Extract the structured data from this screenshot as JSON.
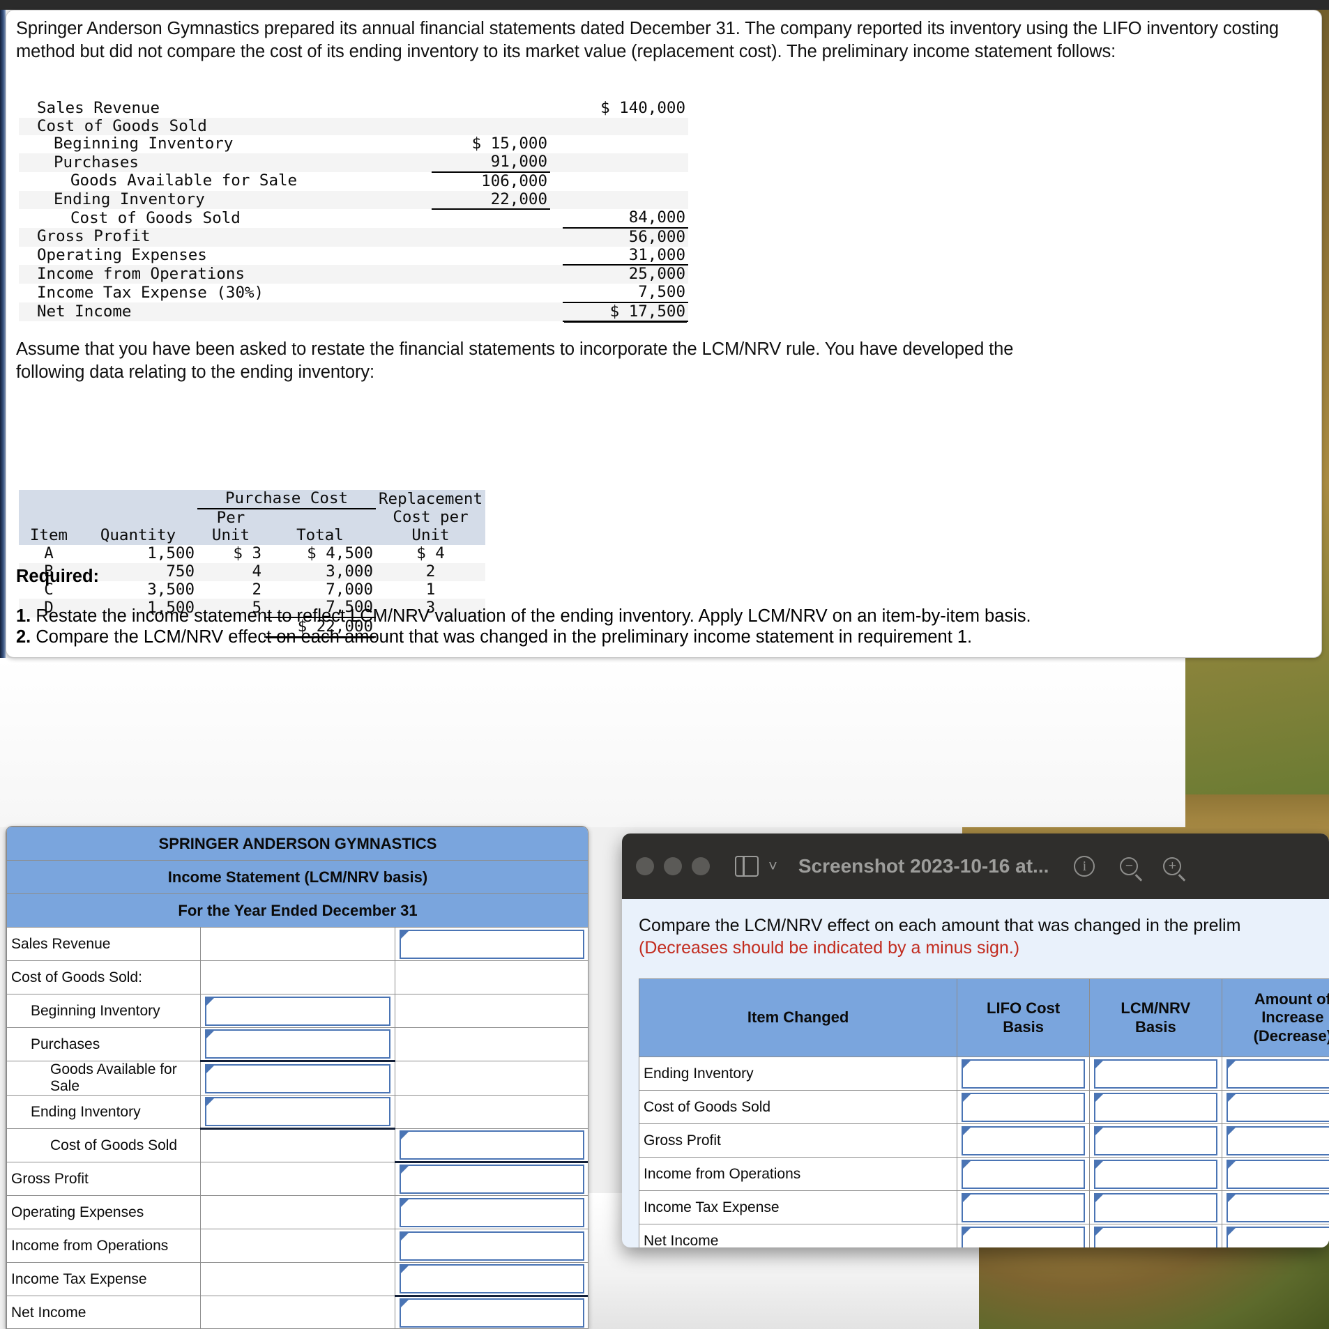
{
  "document": {
    "intro_paragraph": "Springer Anderson Gymnastics prepared its annual financial statements dated December 31. The company reported its inventory using the LIFO inventory costing method but did not compare the cost of its ending inventory to its market value (replacement cost). The preliminary income statement follows:",
    "assume_paragraph": "Assume that you have been asked to restate the financial statements to incorporate the LCM/NRV rule. You have developed the following data relating to the ending inventory:",
    "required_heading": "Required:",
    "requirements": [
      {
        "number": "1.",
        "text": " Restate the income statement to reflect LCM/NRV valuation of the ending inventory. Apply LCM/NRV on an item-by-item basis."
      },
      {
        "number": "2.",
        "text": " Compare the LCM/NRV effect on each amount that was changed in the preliminary income statement in requirement 1."
      }
    ]
  },
  "preliminary_income_statement": {
    "rows": [
      {
        "label": "Sales Revenue",
        "indent": 0,
        "col1": "",
        "col2": "$ 140,000",
        "col1_rule": "none",
        "col2_rule": "none"
      },
      {
        "label": "Cost of Goods Sold",
        "indent": 0,
        "col1": "",
        "col2": "",
        "col1_rule": "none",
        "col2_rule": "none"
      },
      {
        "label": "Beginning Inventory",
        "indent": 1,
        "col1": "$ 15,000",
        "col2": "",
        "col1_rule": "none",
        "col2_rule": "none"
      },
      {
        "label": "Purchases",
        "indent": 1,
        "col1": "91,000",
        "col2": "",
        "col1_rule": "single",
        "col2_rule": "none"
      },
      {
        "label": "Goods Available for Sale",
        "indent": 2,
        "col1": "106,000",
        "col2": "",
        "col1_rule": "none",
        "col2_rule": "none"
      },
      {
        "label": "Ending Inventory",
        "indent": 1,
        "col1": "22,000",
        "col2": "",
        "col1_rule": "single",
        "col2_rule": "none"
      },
      {
        "label": "Cost of Goods Sold",
        "indent": 2,
        "col1": "",
        "col2": "84,000",
        "col1_rule": "none",
        "col2_rule": "single"
      },
      {
        "label": "Gross Profit",
        "indent": 0,
        "col1": "",
        "col2": "56,000",
        "col1_rule": "none",
        "col2_rule": "none"
      },
      {
        "label": "Operating Expenses",
        "indent": 0,
        "col1": "",
        "col2": "31,000",
        "col1_rule": "none",
        "col2_rule": "single"
      },
      {
        "label": "Income from Operations",
        "indent": 0,
        "col1": "",
        "col2": "25,000",
        "col1_rule": "none",
        "col2_rule": "none"
      },
      {
        "label": "Income Tax Expense (30%)",
        "indent": 0,
        "col1": "",
        "col2": "7,500",
        "col1_rule": "none",
        "col2_rule": "single"
      },
      {
        "label": "Net Income",
        "indent": 0,
        "col1": "",
        "col2": "$ 17,500",
        "col1_rule": "none",
        "col2_rule": "double"
      }
    ]
  },
  "purchase_cost_table": {
    "group_header": "Purchase Cost",
    "replacement_header_line1": "Replacement",
    "replacement_header_line2": "Cost per",
    "per_line1": "Per",
    "headers": {
      "item": "Item",
      "quantity": "Quantity",
      "per_unit": "Unit",
      "total": "Total",
      "replacement_unit": "Unit"
    },
    "rows": [
      {
        "item": "A",
        "quantity": "1,500",
        "per_unit": "$ 3",
        "total": "$ 4,500",
        "replacement": "$ 4"
      },
      {
        "item": "B",
        "quantity": "750",
        "per_unit": "4",
        "total": "3,000",
        "replacement": "2"
      },
      {
        "item": "C",
        "quantity": "3,500",
        "per_unit": "2",
        "total": "7,000",
        "replacement": "1"
      },
      {
        "item": "D",
        "quantity": "1,500",
        "per_unit": "5",
        "total": "7,500",
        "replacement": "3"
      }
    ],
    "total_row": {
      "total": "$ 22,000"
    }
  },
  "answer_sheet": {
    "title_line1": "SPRINGER ANDERSON GYMNASTICS",
    "title_line2": "Income Statement (LCM/NRV basis)",
    "title_line3": "For the Year Ended December 31",
    "rows": [
      {
        "label": "Sales Revenue",
        "indent": 0,
        "col_a": "",
        "col_b": "input",
        "under_a": false,
        "under_b": false
      },
      {
        "label": "Cost of Goods Sold:",
        "indent": 0,
        "col_a": "",
        "col_b": "",
        "under_a": false,
        "under_b": false
      },
      {
        "label": "Beginning Inventory",
        "indent": 1,
        "col_a": "input",
        "col_b": "",
        "under_a": false,
        "under_b": false
      },
      {
        "label": "Purchases",
        "indent": 1,
        "col_a": "input",
        "col_b": "",
        "under_a": true,
        "under_b": false
      },
      {
        "label": "Goods Available for Sale",
        "indent": 2,
        "col_a": "input",
        "col_b": "",
        "under_a": false,
        "under_b": false
      },
      {
        "label": "Ending Inventory",
        "indent": 1,
        "col_a": "input",
        "col_b": "",
        "under_a": true,
        "under_b": false
      },
      {
        "label": "Cost of Goods Sold",
        "indent": 2,
        "col_a": "",
        "col_b": "input",
        "under_a": false,
        "under_b": true
      },
      {
        "label": "Gross Profit",
        "indent": 0,
        "col_a": "",
        "col_b": "input",
        "under_a": false,
        "under_b": false
      },
      {
        "label": "Operating Expenses",
        "indent": 0,
        "col_a": "",
        "col_b": "input",
        "under_a": false,
        "under_b": false
      },
      {
        "label": "Income from Operations",
        "indent": 0,
        "col_a": "",
        "col_b": "input",
        "under_a": false,
        "under_b": false
      },
      {
        "label": "Income Tax Expense",
        "indent": 0,
        "col_a": "",
        "col_b": "input",
        "under_a": false,
        "under_b": true
      },
      {
        "label": "Net Income",
        "indent": 0,
        "col_a": "",
        "col_b": "input",
        "under_a": false,
        "under_b": true
      }
    ]
  },
  "screenshot_window": {
    "title": "Screenshot 2023-10-16 at...",
    "traffic_lights": [
      "close-dot",
      "minimize-dot",
      "zoom-dot"
    ],
    "toolbar_icons": [
      "sidebar-icon",
      "chevron-down-icon",
      "info-icon",
      "zoom-out-icon",
      "zoom-in-icon"
    ],
    "question_text": "Compare the LCM/NRV effect on each amount that was changed in the prelim",
    "note_text": "(Decreases should be indicated by a minus sign.)",
    "table": {
      "headers": {
        "item": "Item Changed",
        "lifo_line1": "LIFO Cost",
        "lifo_line2": "Basis",
        "lcm_line1": "LCM/NRV",
        "lcm_line2": "Basis",
        "amt_line1": "Amount of",
        "amt_line2": "Increase",
        "amt_line3": "(Decrease)"
      },
      "rows": [
        {
          "item": "Ending Inventory"
        },
        {
          "item": "Cost of Goods Sold"
        },
        {
          "item": "Gross Profit"
        },
        {
          "item": "Income from Operations"
        },
        {
          "item": "Income Tax Expense"
        },
        {
          "item": "Net Income"
        }
      ]
    }
  },
  "colors": {
    "header_blue": "#7aa5dd",
    "table_header_grey_blue": "#d4dce8",
    "input_border": "#4a74b4",
    "note_red": "#c22b1e",
    "titlebar_dark": "#2f2e2c",
    "question_bg": "#e9f1fb"
  }
}
